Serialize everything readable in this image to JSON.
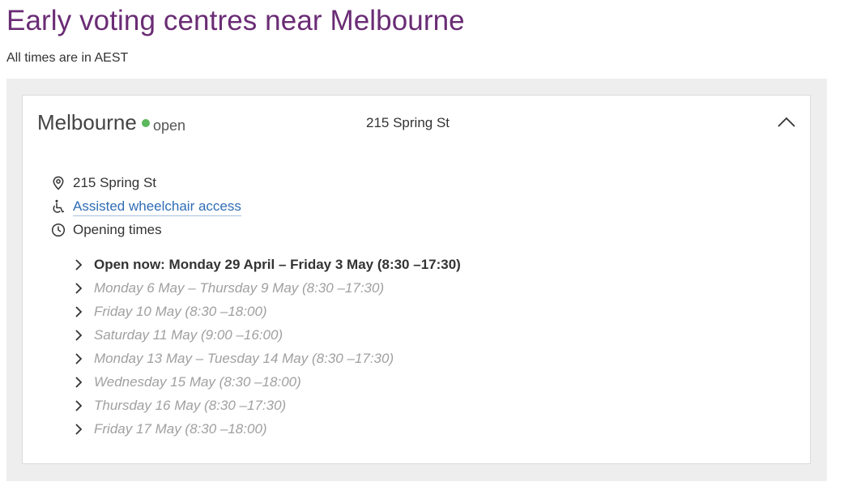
{
  "page": {
    "title": "Early voting centres near Melbourne",
    "timezone_note": "All times are in AEST"
  },
  "centre": {
    "name": "Melbourne",
    "status": "open",
    "status_color": "#5cb85c",
    "header_address": "215 Spring St",
    "collapse_icon": "chevron-up-icon",
    "details": {
      "address": "215 Spring St",
      "accessibility": "Assisted wheelchair access",
      "opening_times_label": "Opening times"
    },
    "opening_times": [
      {
        "label": "Open now: Monday 29 April – Friday 3 May (8:30 –17:30)",
        "current": true
      },
      {
        "label": "Monday 6 May – Thursday 9 May (8:30 –17:30)",
        "current": false
      },
      {
        "label": "Friday 10 May (8:30 –18:00)",
        "current": false
      },
      {
        "label": "Saturday 11 May (9:00 –16:00)",
        "current": false
      },
      {
        "label": "Monday 13 May – Tuesday 14 May (8:30 –17:30)",
        "current": false
      },
      {
        "label": "Wednesday 15 May (8:30 –18:00)",
        "current": false
      },
      {
        "label": "Thursday 16 May (8:30 –17:30)",
        "current": false
      },
      {
        "label": "Friday 17 May (8:30 –18:00)",
        "current": false
      }
    ]
  },
  "colors": {
    "title": "#6a2c75",
    "link": "#2f6db5",
    "panel_bg": "#eeeeee",
    "muted_text": "#a0a0a0"
  }
}
